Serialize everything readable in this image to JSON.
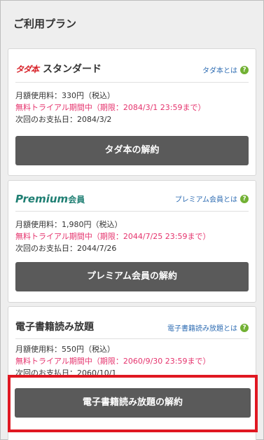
{
  "section_title": "ご利用プラン",
  "plans": [
    {
      "logo_text": "タダ本",
      "name": "スタンダード",
      "about_link": "タダ本とは",
      "fee": "月額使用料：330円（税込）",
      "trial": "無料トライアル期間中（期限：2084/3/1 23:59まで）",
      "next_payment": "次回のお支払日：2084/3/2",
      "cancel_button": "タダ本の解約"
    },
    {
      "logo_text": "Premium",
      "logo_suffix": "会員",
      "about_link": "プレミアム会員とは",
      "fee": "月額使用料：1,980円（税込）",
      "trial": "無料トライアル期間中（期限：2044/7/25 23:59まで）",
      "next_payment": "次回のお支払日：2044/7/26",
      "cancel_button": "プレミアム会員の解約"
    },
    {
      "name": "電子書籍読み放題",
      "about_link": "電子書籍読み放題とは",
      "fee": "月額使用料：550円（税込）",
      "trial": "無料トライアル期間中（期限：2060/9/30 23:59まで）",
      "next_payment": "次回のお支払日：2060/10/1",
      "cancel_button": "電子書籍読み放題の解約"
    }
  ],
  "help_icon": "question-icon",
  "colors": {
    "trial_text": "#e5336d",
    "button_bg": "#5a5a5a",
    "link": "#2f6db3",
    "help_icon_bg": "#72b134",
    "highlight_border": "#e01822",
    "logo_red": "#d8232a",
    "premium_green": "#1f7f73"
  }
}
